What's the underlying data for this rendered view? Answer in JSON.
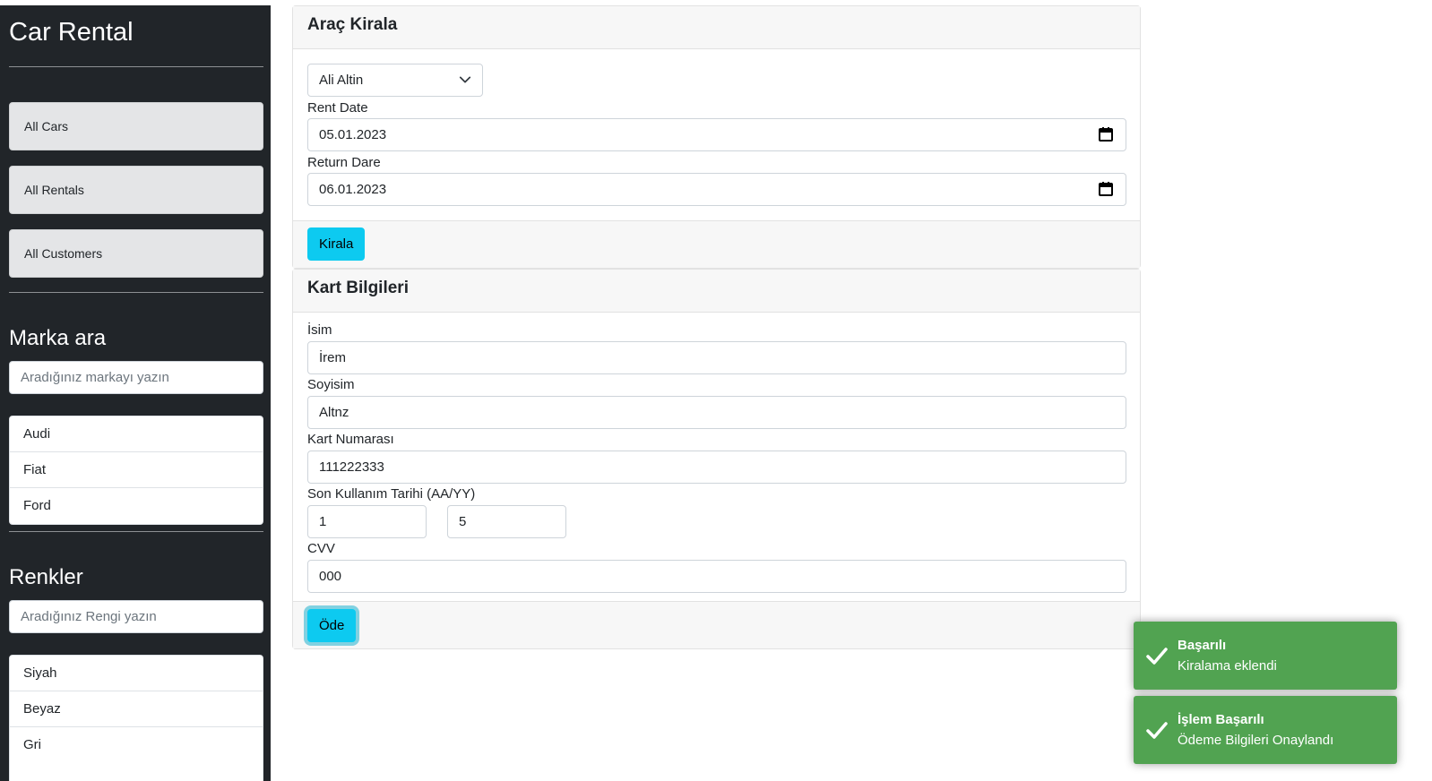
{
  "sidebar": {
    "brand": "Car Rental",
    "nav": [
      {
        "label": "All Cars"
      },
      {
        "label": "All Rentals"
      },
      {
        "label": "All Customers"
      }
    ],
    "brand_search": {
      "title": "Marka ara",
      "placeholder": "Aradığınız markayı yazın",
      "items": [
        "Audi",
        "Fiat",
        "Ford"
      ]
    },
    "color_search": {
      "title": "Renkler",
      "placeholder": "Aradığınız Rengi yazın",
      "items": [
        "Siyah",
        "Beyaz",
        "Gri"
      ]
    }
  },
  "rent_card": {
    "title": "Araç Kirala",
    "customer_select": {
      "value": "Ali Altin",
      "icon": "chevron-down-icon"
    },
    "rent_date": {
      "label": "Rent Date",
      "value": "05.01.2023",
      "icon": "calendar-icon"
    },
    "return_date": {
      "label": "Return Dare",
      "value": "06.01.2023",
      "icon": "calendar-icon"
    },
    "submit_label": "Kirala"
  },
  "card_info": {
    "title": "Kart Bilgileri",
    "first_name": {
      "label": "İsim",
      "value": "İrem"
    },
    "last_name": {
      "label": "Soyisim",
      "value": "Altnz"
    },
    "card_number": {
      "label": "Kart Numarası",
      "value": "111222333"
    },
    "expiry": {
      "label": "Son Kullanım Tarihi (AA/YY)",
      "month": "1",
      "year": "5"
    },
    "cvv": {
      "label": "CVV",
      "value": "000"
    },
    "pay_label": "Öde"
  },
  "toasts": [
    {
      "title": "Başarılı",
      "message": "Kiralama eklendi",
      "icon": "check-icon"
    },
    {
      "title": "İşlem Başarılı",
      "message": "Ödeme Bilgileri Onaylandı",
      "icon": "check-icon"
    }
  ],
  "colors": {
    "sidebar_bg": "#212529",
    "info_button": "#0dcaf0",
    "toast_success": "#51a351"
  }
}
